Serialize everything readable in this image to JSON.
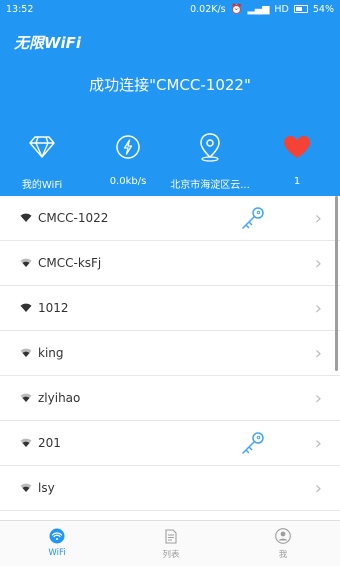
{
  "status_bar": {
    "time": "13:52",
    "speed": "0.02K/s",
    "network": "HD",
    "battery": "54%"
  },
  "header": {
    "app_title": "无限WiFi",
    "connection_status": "成功连接\"CMCC-1022\"",
    "stats": [
      {
        "icon": "diamond-icon",
        "label": "我的WiFi"
      },
      {
        "icon": "speed-icon",
        "label": "0.0kb/s"
      },
      {
        "icon": "location-pin-icon",
        "label": "北京市海淀区云..."
      },
      {
        "icon": "heart-icon",
        "label": "1"
      }
    ]
  },
  "networks": [
    {
      "ssid": "CMCC-1022",
      "has_key": true
    },
    {
      "ssid": "CMCC-ksFj",
      "has_key": false
    },
    {
      "ssid": "1012",
      "has_key": false
    },
    {
      "ssid": "king",
      "has_key": false
    },
    {
      "ssid": "zlyihao",
      "has_key": false
    },
    {
      "ssid": "201",
      "has_key": true
    },
    {
      "ssid": "lsy",
      "has_key": false
    }
  ],
  "tabs": [
    {
      "label": "WiFi",
      "icon": "wifi-icon",
      "active": true
    },
    {
      "label": "列表",
      "icon": "document-icon",
      "active": false
    },
    {
      "label": "我",
      "icon": "user-icon",
      "active": false
    }
  ],
  "colors": {
    "primary": "#2196F3",
    "heart": "#F44336"
  }
}
